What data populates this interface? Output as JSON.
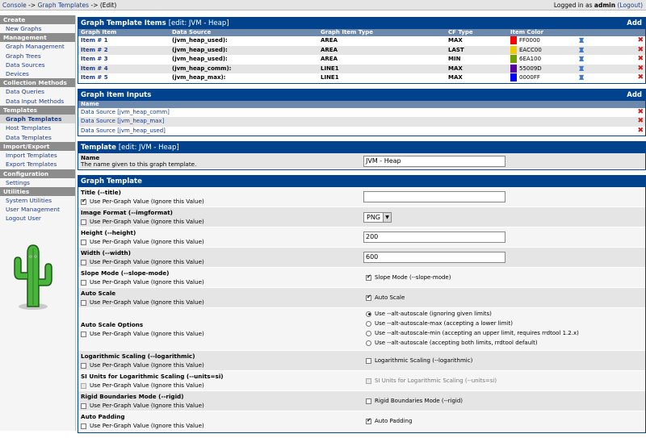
{
  "topbar": {
    "crumb1": "Console",
    "sep1": "->",
    "crumb2": "Graph Templates",
    "sep2": "->",
    "crumb3": "(Edit)",
    "logged_prefix": "Logged in as",
    "user": "admin",
    "logout": "(Logout)"
  },
  "sidebar": {
    "sections": [
      {
        "title": "Create",
        "items": [
          "New Graphs"
        ]
      },
      {
        "title": "Management",
        "items": [
          "Graph Management",
          "Graph Trees",
          "Data Sources",
          "Devices"
        ]
      },
      {
        "title": "Collection Methods",
        "items": [
          "Data Queries",
          "Data Input Methods"
        ]
      },
      {
        "title": "Templates",
        "items": [
          "Graph Templates",
          "Host Templates",
          "Data Templates"
        ]
      },
      {
        "title": "Import/Export",
        "items": [
          "Import Templates",
          "Export Templates"
        ]
      },
      {
        "title": "Configuration",
        "items": [
          "Settings"
        ]
      },
      {
        "title": "Utilities",
        "items": [
          "System Utilities",
          "User Management",
          "Logout User"
        ]
      }
    ],
    "active": "Graph Templates"
  },
  "items_panel": {
    "title": "Graph Template Items",
    "subtitle": "[edit: JVM - Heap]",
    "add": "Add",
    "headers": [
      "Graph Item",
      "Data Source",
      "Graph Item Type",
      "CF Type",
      "Item Color"
    ],
    "rows": [
      {
        "item": "Item # 1",
        "ds": "(jvm_heap_used):",
        "type": "AREA",
        "cf": "MAX",
        "color_hex": "FF0000",
        "color": "#ff0000"
      },
      {
        "item": "Item # 2",
        "ds": "(jvm_heap_used):",
        "type": "AREA",
        "cf": "LAST",
        "color_hex": "EACC00",
        "color": "#eacc00"
      },
      {
        "item": "Item # 3",
        "ds": "(jvm_heap_used):",
        "type": "AREA",
        "cf": "MIN",
        "color_hex": "6EA100",
        "color": "#6ea100"
      },
      {
        "item": "Item # 4",
        "ds": "(jvm_heap_comm):",
        "type": "LINE1",
        "cf": "MAX",
        "color_hex": "55009D",
        "color": "#55009d"
      },
      {
        "item": "Item # 5",
        "ds": "(jvm_heap_max):",
        "type": "LINE1",
        "cf": "MAX",
        "color_hex": "0000FF",
        "color": "#0000ff"
      }
    ]
  },
  "inputs_panel": {
    "title": "Graph Item Inputs",
    "add": "Add",
    "header": "Name",
    "rows": [
      "Data Source [jvm_heap_comm]",
      "Data Source [jvm_heap_max]",
      "Data Source [jvm_heap_used]"
    ]
  },
  "template_panel": {
    "title": "Template",
    "subtitle": "[edit: JVM - Heap]",
    "name_label": "Name",
    "name_desc": "The name given to this graph template.",
    "name_value": "JVM - Heap"
  },
  "graph_panel": {
    "title": "Graph Template",
    "per_graph": "Use Per-Graph Value (Ignore this Value)",
    "fields": {
      "title_label": "Title (--title)",
      "title_value": "",
      "imgformat_label": "Image Format (--imgformat)",
      "imgformat_value": "PNG",
      "height_label": "Height (--height)",
      "height_value": "200",
      "width_label": "Width (--width)",
      "width_value": "600",
      "slope_label": "Slope Mode (--slope-mode)",
      "slope_value": "Slope Mode (--slope-mode)",
      "autoscale_label": "Auto Scale",
      "autoscale_value": "Auto Scale",
      "autoscale_opts_label": "Auto Scale Options",
      "autoscale_opts": [
        "Use --alt-autoscale (ignoring given limits)",
        "Use --alt-autoscale-max (accepting a lower limit)",
        "Use --alt-autoscale-min (accepting an upper limit, requires rrdtool 1.2.x)",
        "Use --alt-autoscale (accepting both limits, rrdtool default)"
      ],
      "log_label": "Logarithmic Scaling (--logarithmic)",
      "log_value": "Logarithmic Scaling (--logarithmic)",
      "si_label": "SI Units for Logarithmic Scaling (--units=si)",
      "si_value": "SI Units for Logarithmic Scaling (--units=si)",
      "rigid_label": "Rigid Boundaries Mode (--rigid)",
      "rigid_value": "Rigid Boundaries Mode (--rigid)",
      "autopad_label": "Auto Padding",
      "autopad_value": "Auto Padding"
    }
  },
  "colors": {
    "header_blue": "#00438c",
    "colhead": "#6d88ad",
    "link": "#1c3c84",
    "delete": "#c82020"
  }
}
